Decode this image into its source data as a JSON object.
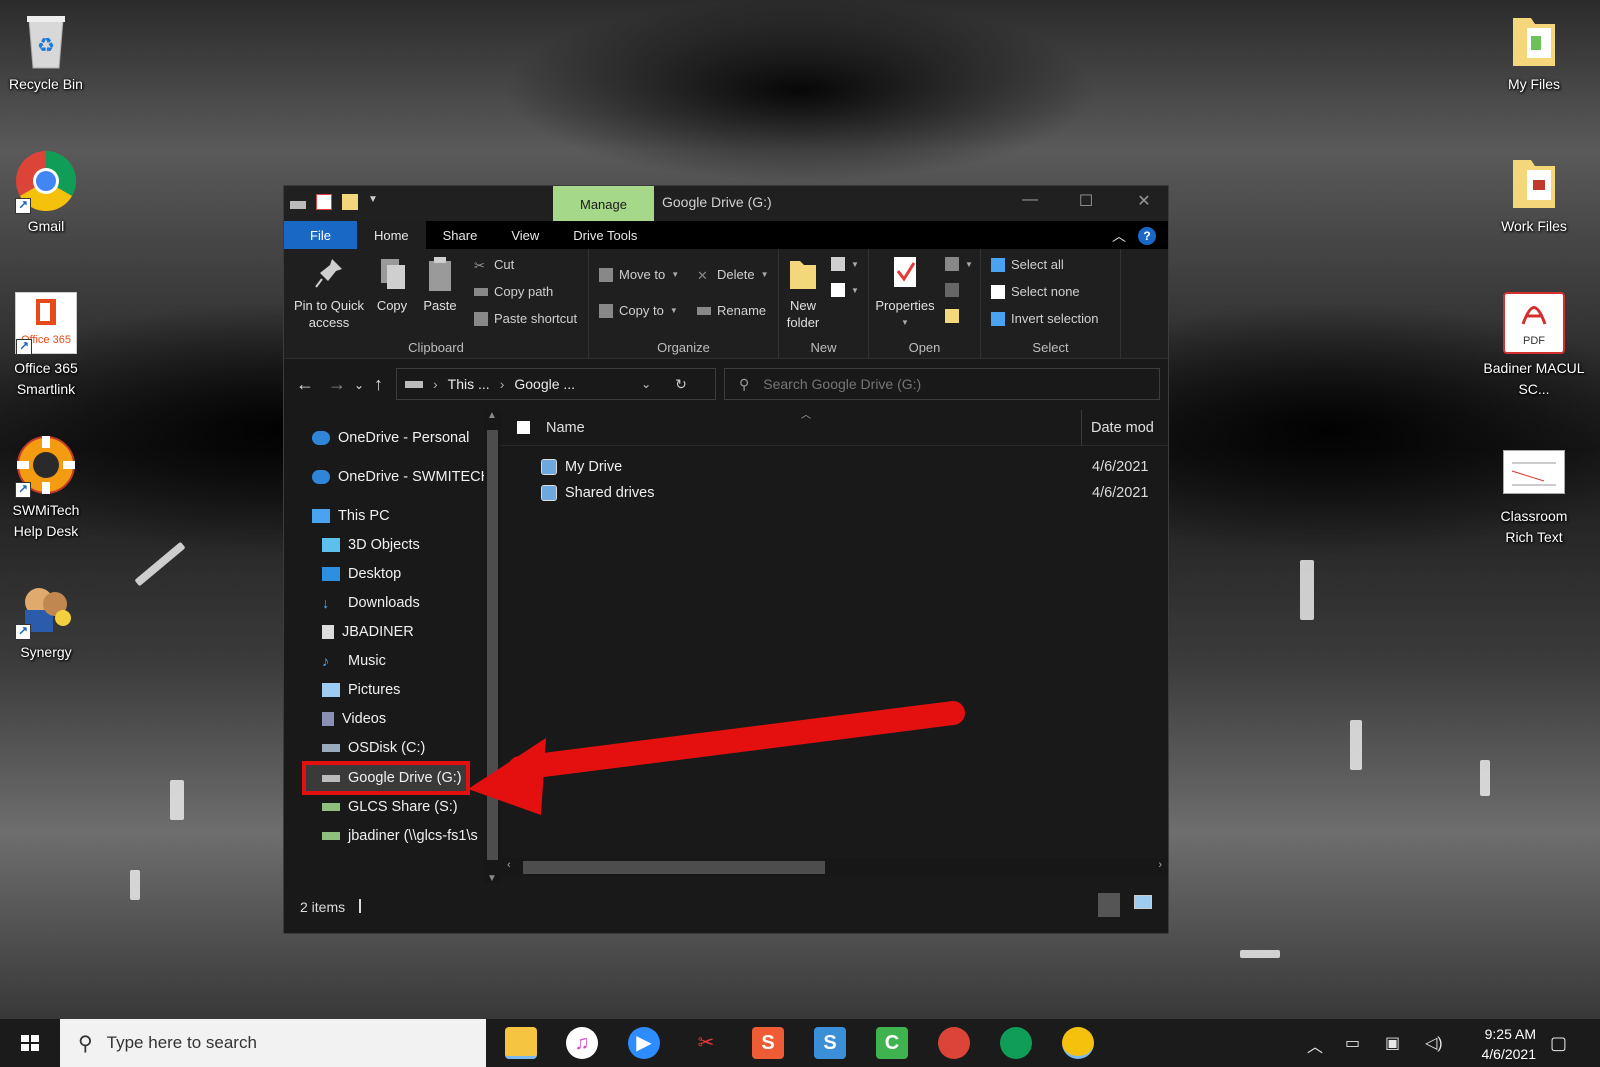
{
  "desktop": {
    "icons_left": [
      {
        "label": "Recycle Bin"
      },
      {
        "label": "Gmail"
      },
      {
        "label": "Office 365 Smartlink",
        "badge": "Office 365"
      },
      {
        "label": "SWMiTech Help Desk"
      },
      {
        "label": "Synergy"
      }
    ],
    "icons_right": [
      {
        "label": "My Files"
      },
      {
        "label": "Work Files"
      },
      {
        "label": "Badiner MACUL SC...",
        "badge": "PDF"
      },
      {
        "label": "Classroom Rich Text"
      }
    ]
  },
  "window": {
    "title": "Google Drive (G:)",
    "context_tab": "Manage",
    "tabs": [
      "File",
      "Home",
      "Share",
      "View",
      "Drive Tools"
    ],
    "help": "?",
    "ribbon": {
      "clipboard": {
        "label": "Clipboard",
        "pin": "Pin to Quick access",
        "copy": "Copy",
        "paste": "Paste",
        "cut": "Cut",
        "copy_path": "Copy path",
        "paste_shortcut": "Paste shortcut"
      },
      "organize": {
        "label": "Organize",
        "move_to": "Move to",
        "copy_to": "Copy to",
        "delete": "Delete",
        "rename": "Rename"
      },
      "new": {
        "label": "New",
        "new_folder": "New folder"
      },
      "open": {
        "label": "Open",
        "properties": "Properties"
      },
      "select": {
        "label": "Select",
        "select_all": "Select all",
        "select_none": "Select none",
        "invert": "Invert selection"
      }
    },
    "address": {
      "crumb1": "This ...",
      "crumb2": "Google ..."
    },
    "search": {
      "placeholder": "Search Google Drive (G:)"
    },
    "nav": [
      {
        "label": "OneDrive - Personal",
        "icon": "cloud-icon"
      },
      {
        "label": "OneDrive - SWMITECH",
        "icon": "cloud-icon"
      },
      {
        "label": "This PC",
        "icon": "computer-icon"
      },
      {
        "label": "3D Objects",
        "icon": "cube-icon"
      },
      {
        "label": "Desktop",
        "icon": "desktop-icon"
      },
      {
        "label": "Downloads",
        "icon": "download-icon"
      },
      {
        "label": "JBADINER",
        "icon": "document-icon"
      },
      {
        "label": "Music",
        "icon": "music-icon"
      },
      {
        "label": "Pictures",
        "icon": "pictures-icon"
      },
      {
        "label": "Videos",
        "icon": "video-icon"
      },
      {
        "label": "OSDisk (C:)",
        "icon": "drive-icon"
      },
      {
        "label": "Google Drive (G:)",
        "icon": "drive-icon",
        "selected": true
      },
      {
        "label": "GLCS Share (S:)",
        "icon": "network-drive-icon"
      },
      {
        "label": "jbadiner (\\\\glcs-fs1\\s",
        "icon": "network-drive-icon"
      }
    ],
    "columns": {
      "name": "Name",
      "date": "Date mod"
    },
    "files": [
      {
        "name": "My Drive",
        "date": "4/6/2021"
      },
      {
        "name": "Shared drives",
        "date": "4/6/2021"
      }
    ],
    "status": {
      "count": "2 items"
    }
  },
  "taskbar": {
    "search_placeholder": "Type here to search",
    "time": "9:25 AM",
    "date": "4/6/2021"
  },
  "colors": {
    "accent": "#1a68c6",
    "manage_tab": "#a6d889",
    "highlight_red": "#e41010"
  }
}
